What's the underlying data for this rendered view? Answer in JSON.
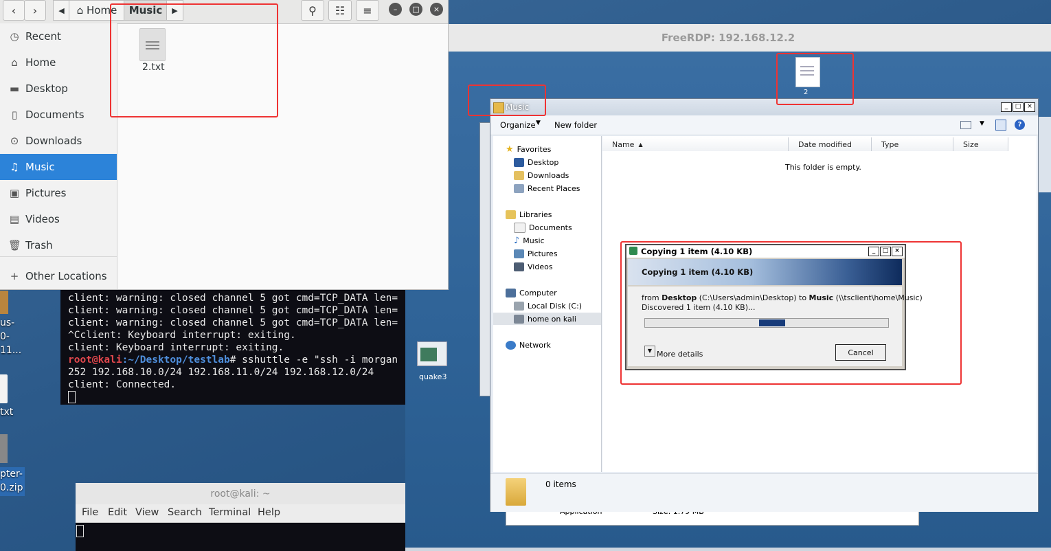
{
  "desktop": {
    "icons": [
      {
        "label": "us-"
      },
      {
        "label": "0-"
      },
      {
        "label": "11..."
      },
      {
        "label": "txt"
      },
      {
        "label": "pter-"
      },
      {
        "label": "0.zip"
      }
    ]
  },
  "file_manager": {
    "path": [
      "Home",
      "Music"
    ],
    "sidebar": [
      {
        "label": "Recent",
        "icon": "clock-icon"
      },
      {
        "label": "Home",
        "icon": "home-icon"
      },
      {
        "label": "Desktop",
        "icon": "folder-icon"
      },
      {
        "label": "Documents",
        "icon": "document-icon"
      },
      {
        "label": "Downloads",
        "icon": "download-icon"
      },
      {
        "label": "Music",
        "icon": "music-icon",
        "active": true
      },
      {
        "label": "Pictures",
        "icon": "camera-icon"
      },
      {
        "label": "Videos",
        "icon": "film-icon"
      },
      {
        "label": "Trash",
        "icon": "trash-icon"
      },
      {
        "label": "Other Locations",
        "icon": "plus-icon"
      }
    ],
    "files": [
      {
        "name": "2.txt"
      }
    ]
  },
  "terminal1": {
    "lines": [
      "client: warning: closed channel 5 got cmd=TCP_DATA len=",
      "client: warning: closed channel 5 got cmd=TCP_DATA len=",
      "client: warning: closed channel 5 got cmd=TCP_DATA len=",
      "^Cclient: Keyboard interrupt: exiting.",
      "client: Keyboard interrupt: exiting."
    ],
    "prompt_user": "root@kali",
    "prompt_path": ":~/Desktop/testlab",
    "prompt_cmd": "# sshuttle -e \"ssh -i morgan",
    "cont_line": "252 192.168.10.0/24 192.168.11.0/24 192.168.12.0/24",
    "connected": "client: Connected."
  },
  "terminal2": {
    "title": "root@kali: ~",
    "menu": [
      "File",
      "Edit",
      "View",
      "Search",
      "Terminal",
      "Help"
    ]
  },
  "rdp": {
    "title": "FreeRDP: 192.168.12.2",
    "desktop_file": "2",
    "quake_label": "quake3",
    "under_explorer": {
      "type": "Application",
      "size": "Size: 1.79 MB"
    }
  },
  "explorer": {
    "title": "Music",
    "toolbar": {
      "organize": "Organize",
      "new_folder": "New folder"
    },
    "nav": {
      "favorites": "Favorites",
      "favorites_items": [
        "Desktop",
        "Downloads",
        "Recent Places"
      ],
      "libraries": "Libraries",
      "libraries_items": [
        "Documents",
        "Music",
        "Pictures",
        "Videos"
      ],
      "computer": "Computer",
      "computer_items": [
        "Local Disk (C:)",
        "home on kali"
      ],
      "network": "Network"
    },
    "columns": [
      "Name",
      "Date modified",
      "Type",
      "Size"
    ],
    "empty_text": "This folder is empty.",
    "status": "0 items"
  },
  "copy_dialog": {
    "title": "Copying 1 item (4.10 KB)",
    "heading": "Copying 1 item (4.10 KB)",
    "from_word": "from",
    "source": "Desktop",
    "source_path": "(C:\\Users\\admin\\Desktop)",
    "to_word": "to",
    "dest": "Music",
    "dest_path": "(\\\\tsclient\\home\\Music)",
    "discovered": "Discovered 1 item (4.10 KB)...",
    "more_details": "More details",
    "cancel": "Cancel"
  },
  "colors": {
    "accent": "#2c83d9",
    "annotation_red": "#e33333"
  }
}
